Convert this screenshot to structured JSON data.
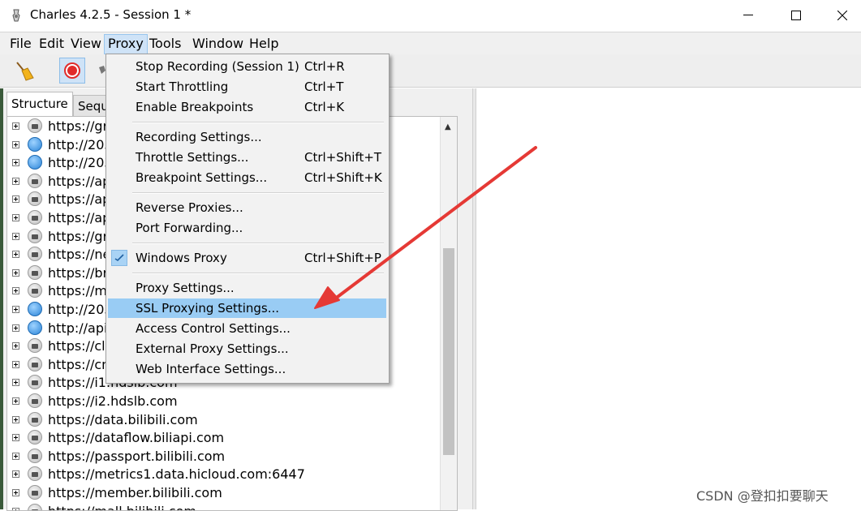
{
  "window": {
    "title": "Charles 4.2.5 - Session 1 *",
    "controls": [
      "minimize",
      "maximize",
      "close"
    ]
  },
  "menubar": {
    "items": [
      "File",
      "Edit",
      "View",
      "Proxy",
      "Tools",
      "Window",
      "Help"
    ],
    "active": "Proxy"
  },
  "toolbar": {
    "buttons": [
      "broom-icon",
      "record-icon",
      "throttle-icon"
    ]
  },
  "structure": {
    "tabs": [
      "Structure",
      "Sequ"
    ],
    "rows": [
      {
        "label": "https://gr",
        "icon": "lock"
      },
      {
        "label": "http://203",
        "icon": "globe"
      },
      {
        "label": "http://203",
        "icon": "globe"
      },
      {
        "label": "https://ap",
        "icon": "lock"
      },
      {
        "label": "https://ap",
        "icon": "lock"
      },
      {
        "label": "https://ap",
        "icon": "lock"
      },
      {
        "label": "https://gr",
        "icon": "lock"
      },
      {
        "label": "https://ne",
        "icon": "lock"
      },
      {
        "label": "https://br",
        "icon": "lock"
      },
      {
        "label": "https://me",
        "icon": "lock"
      },
      {
        "label": "http://203",
        "icon": "globe"
      },
      {
        "label": "http://api.",
        "icon": "globe"
      },
      {
        "label": "https://clu",
        "icon": "lock"
      },
      {
        "label": "https://cm",
        "icon": "lock"
      },
      {
        "label": "https://i1.hdslb.com",
        "icon": "lock"
      },
      {
        "label": "https://i2.hdslb.com",
        "icon": "lock"
      },
      {
        "label": "https://data.bilibili.com",
        "icon": "lock"
      },
      {
        "label": "https://dataflow.biliapi.com",
        "icon": "lock"
      },
      {
        "label": "https://passport.bilibili.com",
        "icon": "lock"
      },
      {
        "label": "https://metrics1.data.hicloud.com:6447",
        "icon": "lock"
      },
      {
        "label": "https://member.bilibili.com",
        "icon": "lock"
      },
      {
        "label": "https://mall.bilibili.com",
        "icon": "lock"
      }
    ]
  },
  "proxy_menu": {
    "items": [
      {
        "label": "Stop Recording (Session 1)",
        "shortcut": "Ctrl+R"
      },
      {
        "label": "Start Throttling",
        "shortcut": "Ctrl+T"
      },
      {
        "label": "Enable Breakpoints",
        "shortcut": "Ctrl+K"
      },
      {
        "label": "Recording Settings...",
        "shortcut": ""
      },
      {
        "label": "Throttle Settings...",
        "shortcut": "Ctrl+Shift+T"
      },
      {
        "label": "Breakpoint Settings...",
        "shortcut": "Ctrl+Shift+K"
      },
      {
        "label": "Reverse Proxies...",
        "shortcut": ""
      },
      {
        "label": "Port Forwarding...",
        "shortcut": ""
      },
      {
        "label": "Windows Proxy",
        "shortcut": "Ctrl+Shift+P",
        "checked": true
      },
      {
        "label": "Proxy Settings...",
        "shortcut": ""
      },
      {
        "label": "SSL Proxying Settings...",
        "shortcut": "",
        "highlighted": true
      },
      {
        "label": "Access Control Settings...",
        "shortcut": ""
      },
      {
        "label": "External Proxy Settings...",
        "shortcut": ""
      },
      {
        "label": "Web Interface Settings...",
        "shortcut": ""
      }
    ]
  },
  "watermark": "CSDN @登扣扣要聊天",
  "colors": {
    "highlight": "#99ccf4",
    "arrow": "#e53935",
    "menu_active": "#cfe3f7"
  }
}
